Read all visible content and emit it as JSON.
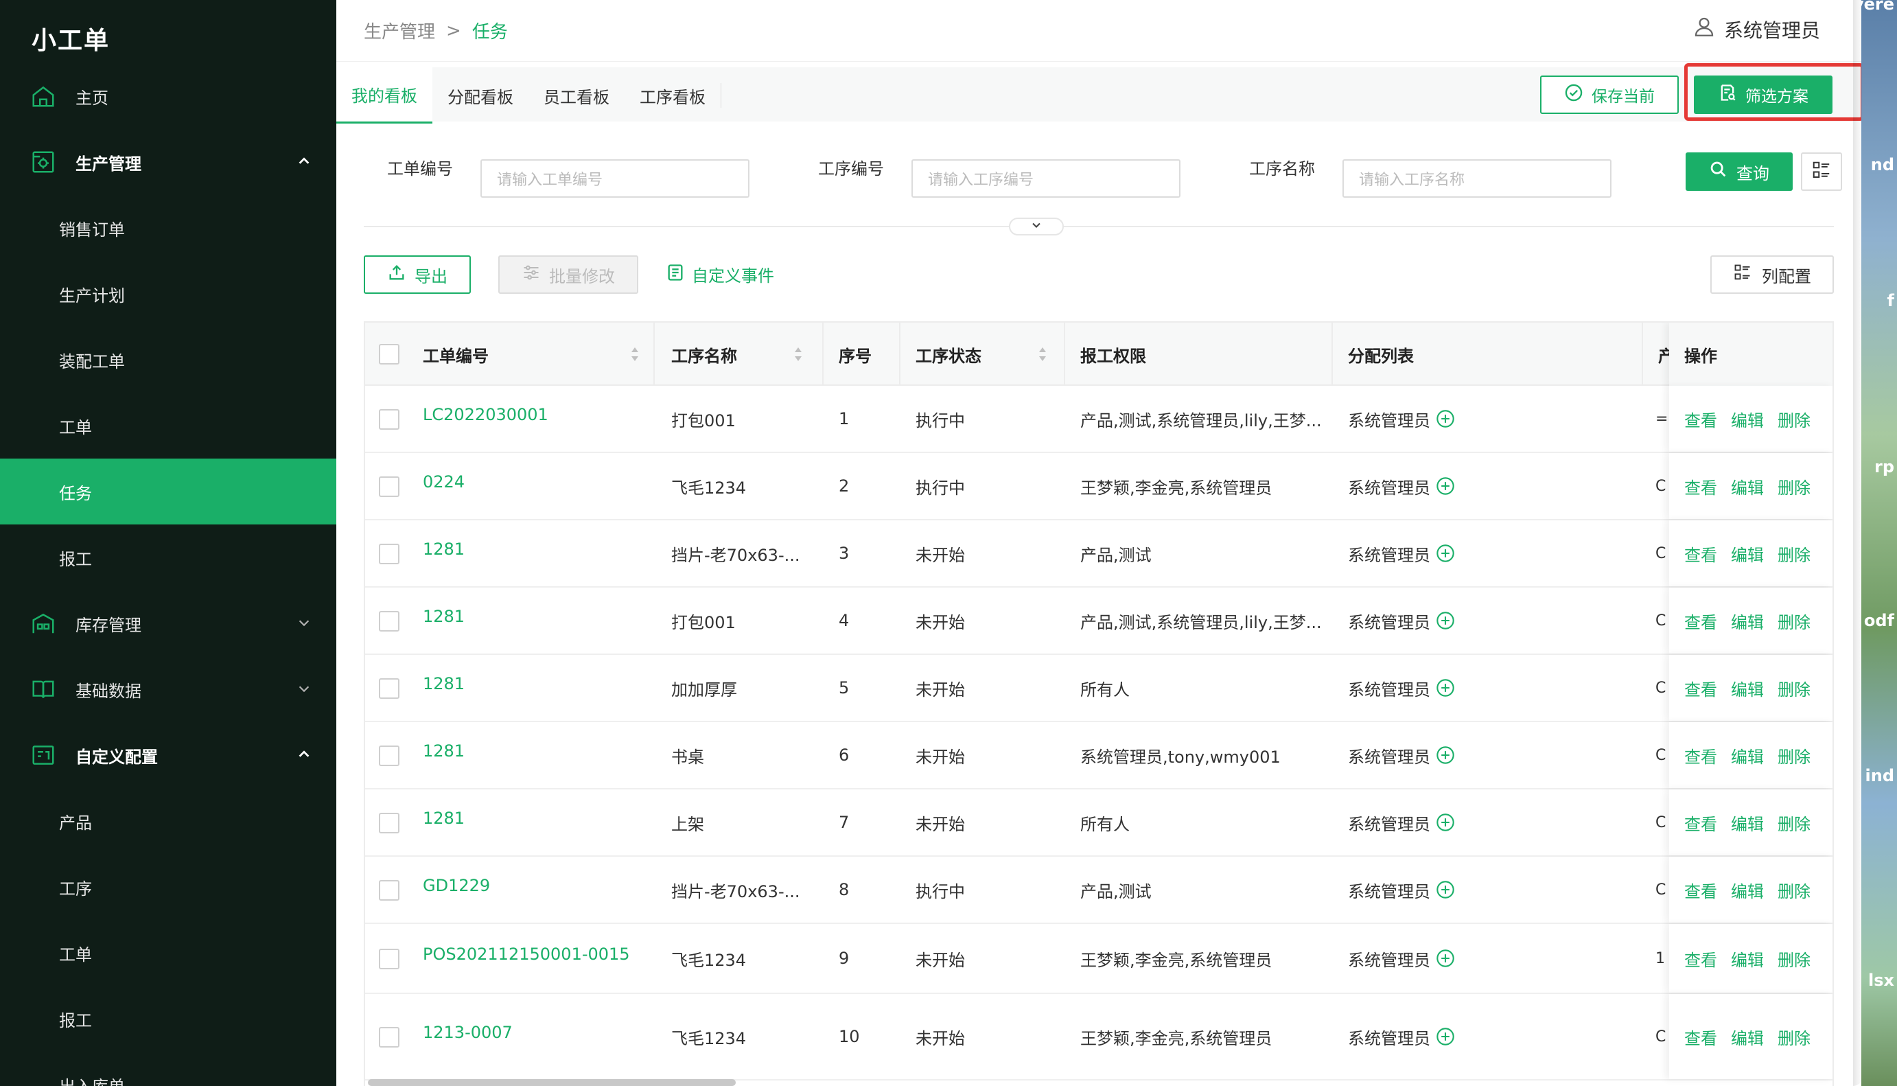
{
  "app": {
    "brand": "小工单",
    "user": "系统管理员"
  },
  "sidebar": {
    "items": [
      {
        "label": "主页",
        "kind": "top",
        "icon": "home-icon"
      },
      {
        "label": "生产管理",
        "kind": "group",
        "icon": "factory-icon",
        "expanded": true
      },
      {
        "label": "销售订单",
        "kind": "sub"
      },
      {
        "label": "生产计划",
        "kind": "sub"
      },
      {
        "label": "装配工单",
        "kind": "sub"
      },
      {
        "label": "工单",
        "kind": "sub"
      },
      {
        "label": "任务",
        "kind": "sub",
        "active": true
      },
      {
        "label": "报工",
        "kind": "sub"
      },
      {
        "label": "库存管理",
        "kind": "top",
        "icon": "warehouse-icon",
        "expanded": false
      },
      {
        "label": "基础数据",
        "kind": "top",
        "icon": "book-icon",
        "expanded": false
      },
      {
        "label": "自定义配置",
        "kind": "group",
        "icon": "config-icon",
        "expanded": true
      },
      {
        "label": "产品",
        "kind": "sub"
      },
      {
        "label": "工序",
        "kind": "sub"
      },
      {
        "label": "工单",
        "kind": "sub"
      },
      {
        "label": "报工",
        "kind": "sub"
      },
      {
        "label": "出入库单",
        "kind": "sub"
      }
    ]
  },
  "breadcrumb": {
    "parent": "生产管理",
    "separator": ">",
    "current": "任务"
  },
  "tabs": [
    "我的看板",
    "分配看板",
    "员工看板",
    "工序看板"
  ],
  "toolbar": {
    "save_label": "保存当前",
    "filter_label": "筛选方案"
  },
  "search": {
    "fields": [
      {
        "label": "工单编号",
        "placeholder": "请输入工单编号"
      },
      {
        "label": "工序编号",
        "placeholder": "请输入工序编号"
      },
      {
        "label": "工序名称",
        "placeholder": "请输入工序名称"
      }
    ],
    "query_label": "查询"
  },
  "actions": {
    "export": "导出",
    "batch": "批量修改",
    "custom_event": "自定义事件",
    "column_config": "列配置"
  },
  "table": {
    "headers": [
      "工单编号",
      "工序名称",
      "序号",
      "工序状态",
      "报工权限",
      "分配列表",
      "产",
      "操作"
    ],
    "rows": [
      {
        "code": "LC2022030001",
        "process": "打包001",
        "seq": "1",
        "status": "执行中",
        "perm": "产品,测试,系统管理员,lily,王梦...",
        "assign": "系统管理员",
        "cut": "="
      },
      {
        "code": "0224",
        "process": "飞毛1234",
        "seq": "2",
        "status": "执行中",
        "perm": "王梦颖,李金亮,系统管理员",
        "assign": "系统管理员",
        "cut": "C"
      },
      {
        "code": "1281",
        "process": "挡片-老70x63-...",
        "seq": "3",
        "status": "未开始",
        "perm": "产品,测试",
        "assign": "系统管理员",
        "cut": "C"
      },
      {
        "code": "1281",
        "process": "打包001",
        "seq": "4",
        "status": "未开始",
        "perm": "产品,测试,系统管理员,lily,王梦...",
        "assign": "系统管理员",
        "cut": "C"
      },
      {
        "code": "1281",
        "process": "加加厚厚",
        "seq": "5",
        "status": "未开始",
        "perm": "所有人",
        "assign": "系统管理员",
        "cut": "C"
      },
      {
        "code": "1281",
        "process": "书桌",
        "seq": "6",
        "status": "未开始",
        "perm": "系统管理员,tony,wmy001",
        "assign": "系统管理员",
        "cut": "C"
      },
      {
        "code": "1281",
        "process": "上架",
        "seq": "7",
        "status": "未开始",
        "perm": "所有人",
        "assign": "系统管理员",
        "cut": "C"
      },
      {
        "code": "GD1229",
        "process": "挡片-老70x63-...",
        "seq": "8",
        "status": "执行中",
        "perm": "产品,测试",
        "assign": "系统管理员",
        "cut": "C"
      },
      {
        "code": "POS202112150001-0015",
        "process": "飞毛1234",
        "seq": "9",
        "status": "未开始",
        "perm": "王梦颖,李金亮,系统管理员",
        "assign": "系统管理员",
        "cut": "1"
      },
      {
        "code": "1213-0007",
        "process": "飞毛1234",
        "seq": "10",
        "status": "未开始",
        "perm": "王梦颖,李金亮,系统管理员",
        "assign": "系统管理员",
        "cut": "C"
      }
    ],
    "ops": [
      "查看",
      "编辑",
      "删除"
    ]
  },
  "desktop": {
    "labels": [
      "overe",
      "nd",
      "f",
      "rp",
      "odf",
      "ind",
      "lsx"
    ]
  },
  "colors": {
    "accent": "#1aaf68",
    "sidebar": "#0f1d17",
    "highlight": "#e53935"
  }
}
